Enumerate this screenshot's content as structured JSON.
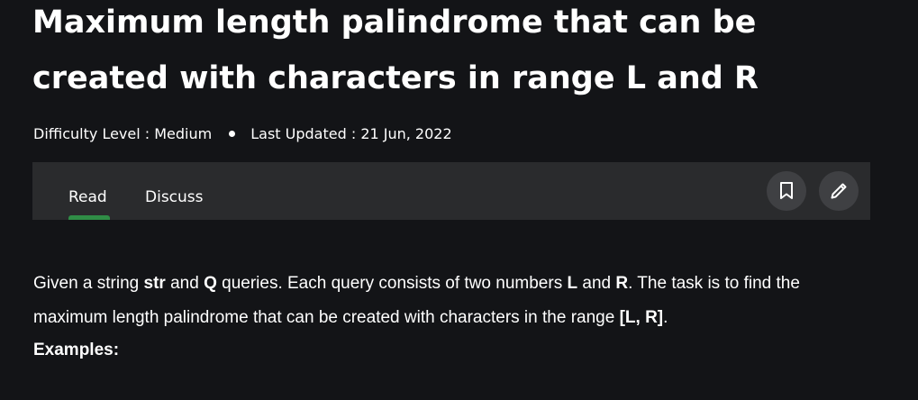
{
  "article": {
    "title": "Maximum length palindrome that can be created with characters in range L and R",
    "difficulty_label": "Difficulty Level : ",
    "difficulty_value": "Medium",
    "updated_label": "Last Updated : ",
    "updated_value": "21 Jun, 2022"
  },
  "tabs": {
    "read": "Read",
    "discuss": "Discuss",
    "active": "Read"
  },
  "actions": {
    "bookmark_icon": "bookmark-icon",
    "edit_icon": "pencil-icon"
  },
  "body": {
    "t1": "Given a string ",
    "b1": "str",
    "t2": " and ",
    "b2": "Q",
    "t3": " queries. Each query consists of two numbers ",
    "b3": "L",
    "t4": " and ",
    "b4": "R",
    "t5": ". The task is to find the maximum length palindrome that can be created with characters in the range ",
    "b5": "[L, R]",
    "t6": ".",
    "examples_heading": "Examples:"
  },
  "colors": {
    "background": "#131417",
    "tabbar": "#2a2b2d",
    "button": "#3f4043",
    "accent": "#2f8d46",
    "text": "#ffffff"
  }
}
